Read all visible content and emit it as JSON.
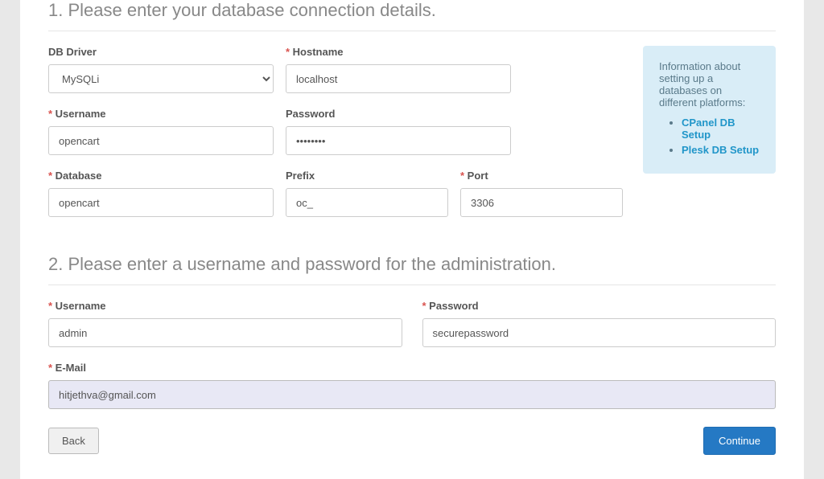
{
  "section1": {
    "heading": "1. Please enter your database connection details."
  },
  "db": {
    "driver_label": "DB Driver",
    "driver_value": "MySQLi",
    "hostname_label": "Hostname",
    "hostname_value": "localhost",
    "username_label": "Username",
    "username_value": "opencart",
    "password_label": "Password",
    "password_value": "password",
    "database_label": "Database",
    "database_value": "opencart",
    "prefix_label": "Prefix",
    "prefix_value": "oc_",
    "port_label": "Port",
    "port_value": "3306"
  },
  "info": {
    "text": "Information about setting up a databases on different platforms:",
    "link1": "CPanel DB Setup",
    "link2": "Plesk DB Setup"
  },
  "section2": {
    "heading": "2. Please enter a username and password for the administration."
  },
  "admin": {
    "username_label": "Username",
    "username_value": "admin",
    "password_label": "Password",
    "password_value": "securepassword",
    "email_label": "E-Mail",
    "email_value": "hitjethva@gmail.com"
  },
  "buttons": {
    "back": "Back",
    "continue": "Continue"
  }
}
